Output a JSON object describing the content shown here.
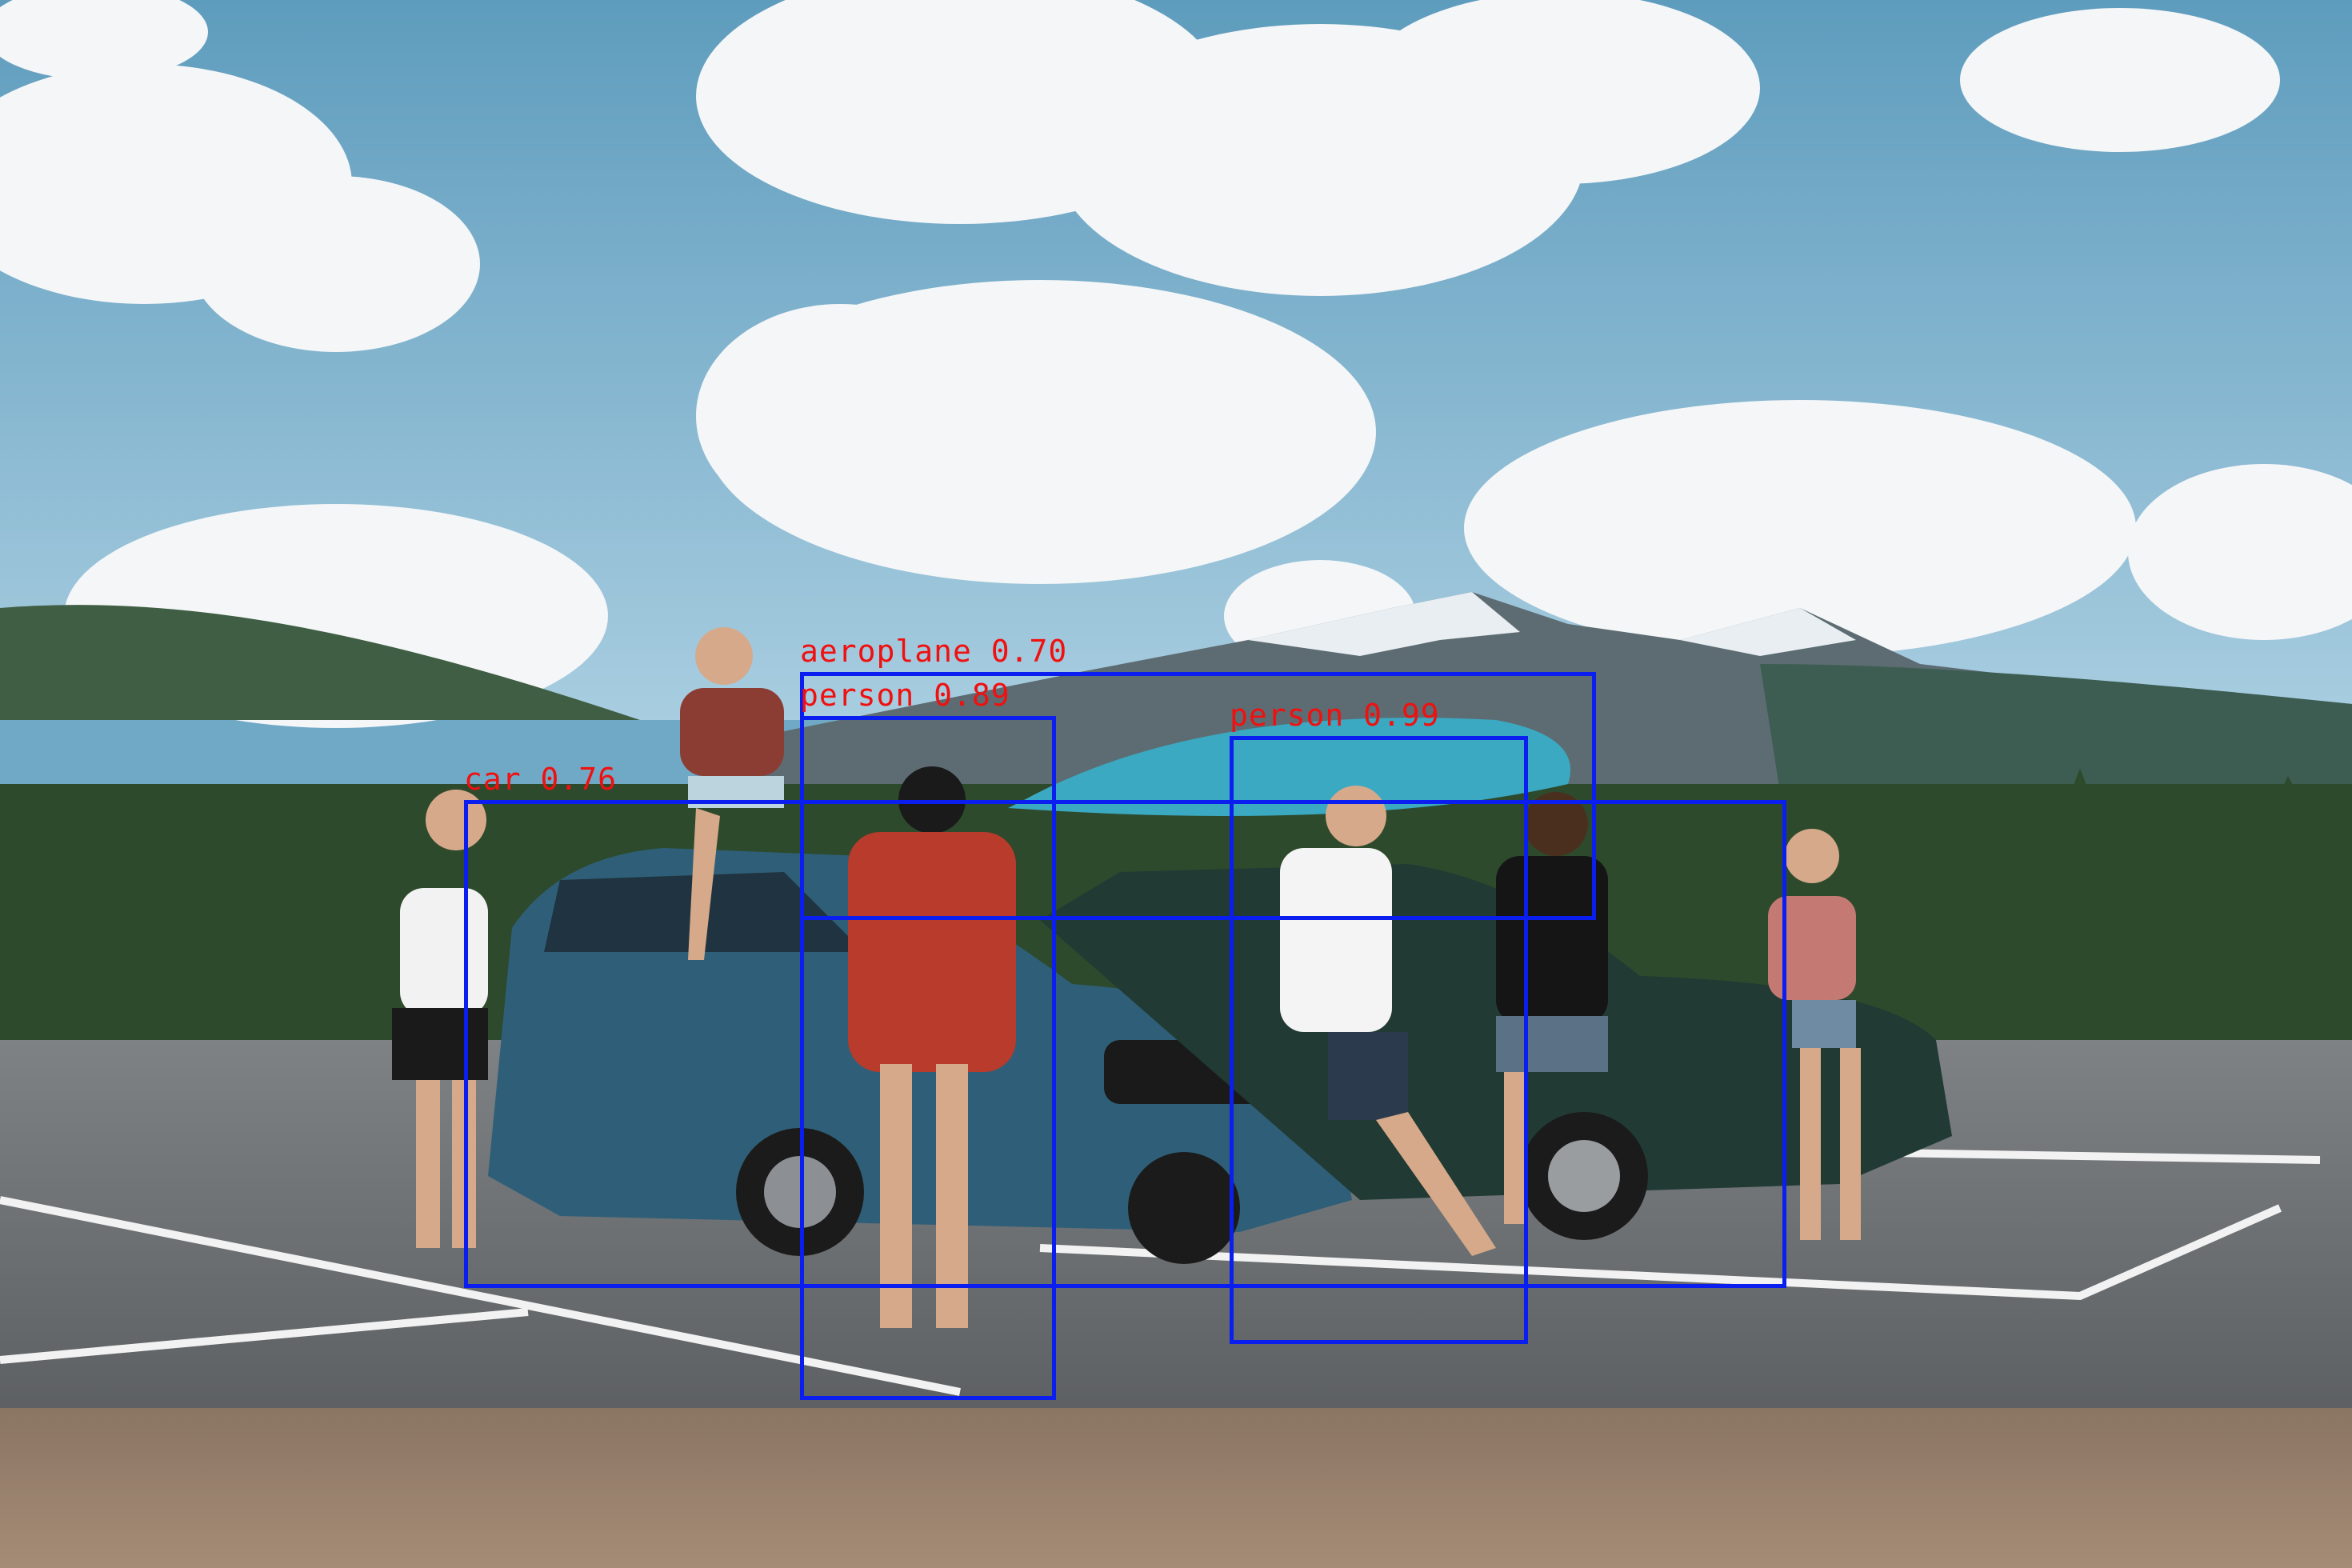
{
  "image": {
    "description_layers": [
      "sky",
      "clouds",
      "mountains",
      "forest",
      "parking-lot",
      "cars",
      "people",
      "gravel"
    ]
  },
  "detections": [
    {
      "label": "aeroplane 0.70"
    },
    {
      "label": "person 0.89"
    },
    {
      "label": "person 0.99"
    },
    {
      "label": "car 0.76"
    }
  ],
  "colors": {
    "box": "#0a1ef0",
    "label": "#f01010"
  }
}
